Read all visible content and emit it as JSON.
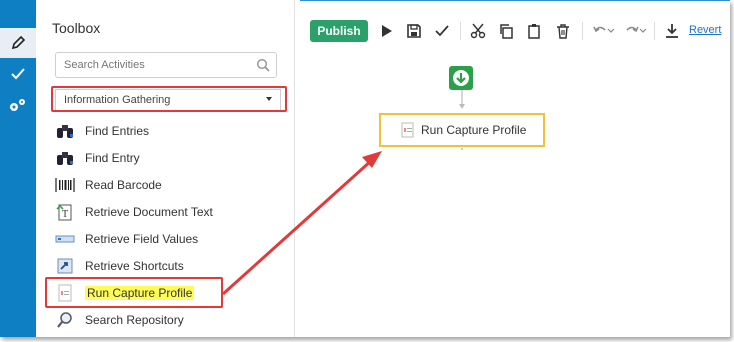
{
  "toolbox": {
    "title": "Toolbox",
    "search_placeholder": "Search Activities",
    "category": "Information Gathering",
    "activities": [
      {
        "label": "Find Entries",
        "icon": "binoculars-icon"
      },
      {
        "label": "Find Entry",
        "icon": "binoculars-icon"
      },
      {
        "label": "Read Barcode",
        "icon": "barcode-icon"
      },
      {
        "label": "Retrieve Document Text",
        "icon": "document-text-icon"
      },
      {
        "label": "Retrieve Field Values",
        "icon": "field-values-icon"
      },
      {
        "label": "Retrieve Shortcuts",
        "icon": "shortcut-icon"
      },
      {
        "label": "Run Capture Profile",
        "icon": "capture-profile-icon"
      },
      {
        "label": "Search Repository",
        "icon": "magnifier-icon"
      }
    ]
  },
  "toolbar": {
    "publish_label": "Publish",
    "revert_label": "Revert"
  },
  "canvas": {
    "node_label": "Run Capture Profile"
  },
  "colors": {
    "sidebar": "#0f7fc3",
    "publish": "#2aa06a",
    "highlight_box": "#e23a3a",
    "node_border": "#f0c23a",
    "text_highlight": "#fffb5a"
  }
}
